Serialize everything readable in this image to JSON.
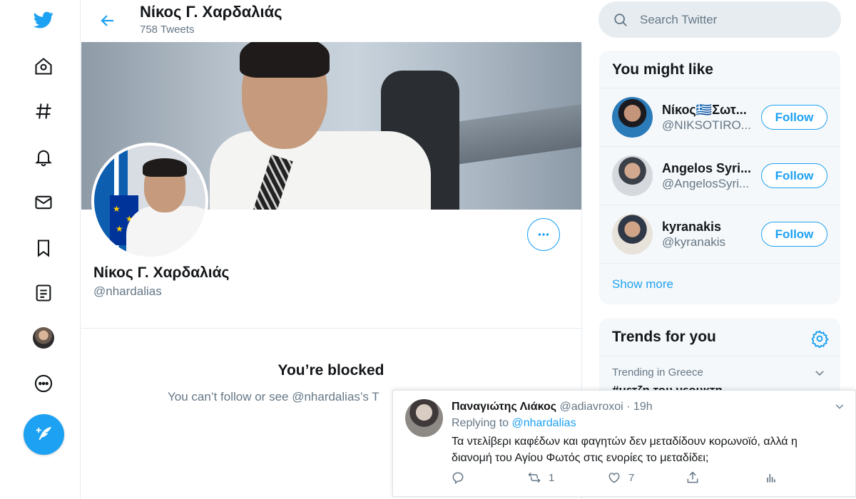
{
  "colors": {
    "accent": "#1da1f2",
    "muted": "#657786",
    "text": "#14171a",
    "panel_bg": "#f5f8fa"
  },
  "nav": {
    "items": [
      {
        "icon": "twitter-bird-icon"
      },
      {
        "icon": "home-icon"
      },
      {
        "icon": "hashtag-icon"
      },
      {
        "icon": "bell-icon"
      },
      {
        "icon": "mail-icon"
      },
      {
        "icon": "bookmark-icon"
      },
      {
        "icon": "list-icon"
      },
      {
        "icon": "profile-avatar"
      },
      {
        "icon": "more-circle-icon"
      }
    ],
    "compose_icon": "compose-feather-icon"
  },
  "header": {
    "title": "Νίκος Γ. Χαρδαλιάς",
    "tweet_count": "758 Tweets",
    "back_icon": "back-arrow-icon"
  },
  "profile": {
    "name": "Νίκος Γ. Χαρδαλιάς",
    "handle": "@nhardalias",
    "more_icon": "more-dots-icon"
  },
  "blocked": {
    "title": "You’re blocked",
    "text": "You can’t follow or see @nhardalias’s T"
  },
  "search": {
    "placeholder": "Search Twitter",
    "value": ""
  },
  "who_to_follow": {
    "title": "You might like",
    "users": [
      {
        "name": "Νίκος🇬🇷Σωτ...",
        "handle": "@NIKSOTIRO...",
        "button": "Follow"
      },
      {
        "name": "Angelos Syri...",
        "handle": "@AngelosSyri...",
        "button": "Follow"
      },
      {
        "name": "kyranakis",
        "handle": "@kyranakis",
        "button": "Follow"
      }
    ],
    "show_more": "Show more"
  },
  "trends": {
    "title": "Trends for you",
    "meta": "Trending in Greece",
    "topic": "#μετζη του νεουκτη"
  },
  "tweet": {
    "author": "Παναγιώτης Λιάκος",
    "handle": "@adiavroxoi",
    "separator": "·",
    "time": "19h",
    "replying_to_label": "Replying to",
    "replying_to_handle": "@nhardalias",
    "text": "Τα ντελίβερι καφέδων και φαγητών δεν μεταδίδουν κορωνοϊό, αλλά η διανομή του Αγίου Φωτός στις ενορίες το μεταδίδει;",
    "retweets": "1",
    "likes": "7"
  }
}
